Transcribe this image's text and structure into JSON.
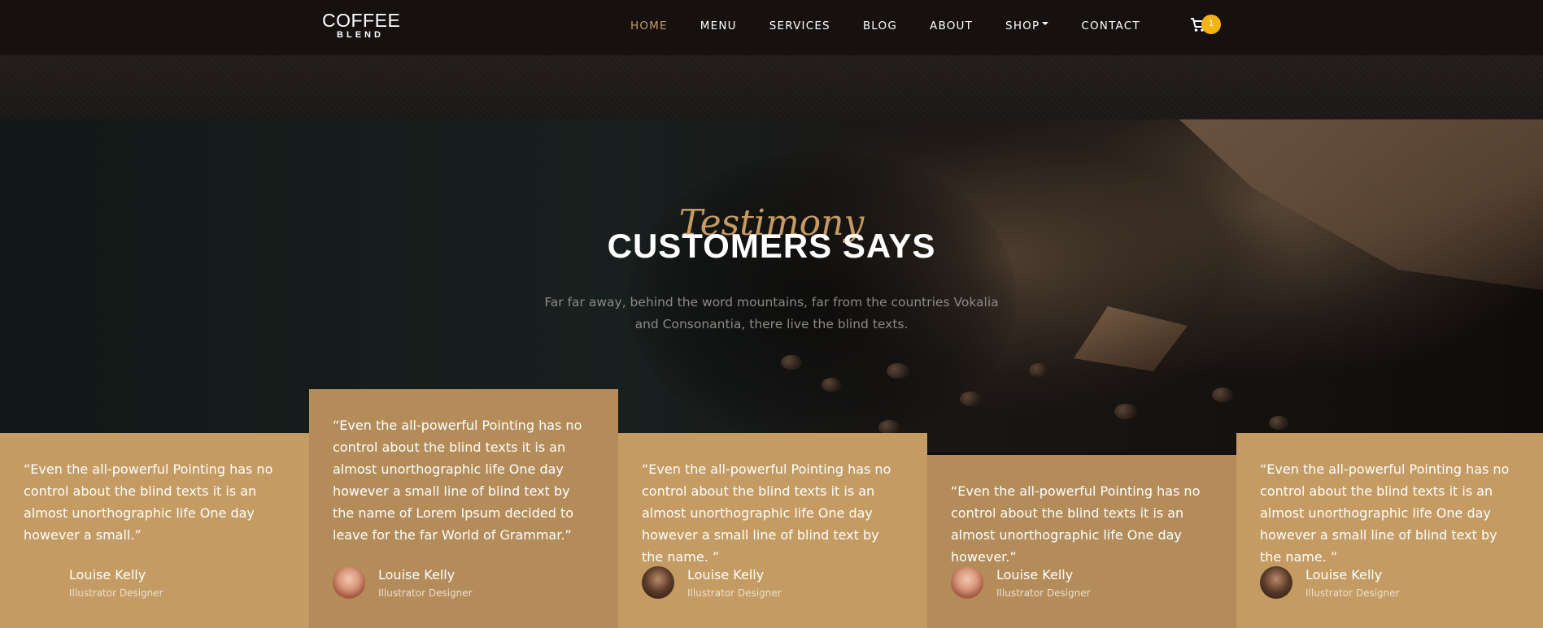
{
  "brand": {
    "top": "COFFEE",
    "bottom": "BLEND"
  },
  "nav": {
    "items": [
      {
        "label": "HOME",
        "active": true
      },
      {
        "label": "MENU"
      },
      {
        "label": "SERVICES"
      },
      {
        "label": "BLOG"
      },
      {
        "label": "ABOUT"
      },
      {
        "label": "SHOP",
        "dropdown": true
      },
      {
        "label": "CONTACT"
      }
    ],
    "cart": {
      "icon": "cart-icon",
      "count": "1"
    }
  },
  "hero": {
    "subheading": "Testimony",
    "heading": "CUSTOMERS SAYS",
    "text": "Far far away, behind the word mountains, far from the countries Vokalia and Consonantia, there live the blind texts."
  },
  "testimonials": [
    {
      "quote": "“Even the all-powerful Pointing has no control about the blind texts it is an almost unorthographic life One day however a small.”",
      "name": "Louise Kelly",
      "position": "Illustrator Designer",
      "avatar": "none"
    },
    {
      "quote": "“Even the all-powerful Pointing has no control about the blind texts it is an almost unorthographic life One day however a small line of blind text by the name of Lorem Ipsum decided to leave for the far World of Grammar.”",
      "name": "Louise Kelly",
      "position": "Illustrator Designer",
      "avatar": "person-photo-a"
    },
    {
      "quote": "“Even the all-powerful Pointing has no control about the blind texts it is an almost unorthographic life One day however a small line of blind text by the name. ”",
      "name": "Louise Kelly",
      "position": "Illustrator Designer",
      "avatar": "person-photo-b"
    },
    {
      "quote": "“Even the all-powerful Pointing has no control about the blind texts it is an almost unorthographic life One day however.”",
      "name": "Louise Kelly",
      "position": "Illustrator Designer",
      "avatar": "person-photo-a"
    },
    {
      "quote": "“Even the all-powerful Pointing has no control about the blind texts it is an almost unorthographic life One day however a small line of blind text by the name. ”",
      "name": "Louise Kelly",
      "position": "Illustrator Designer",
      "avatar": "person-photo-b"
    }
  ],
  "colors": {
    "accent": "#c49b63",
    "card": "#c49b63",
    "card_alt": "#b38c5a",
    "nav_bg": "#161110",
    "badge": "#f2b413"
  }
}
